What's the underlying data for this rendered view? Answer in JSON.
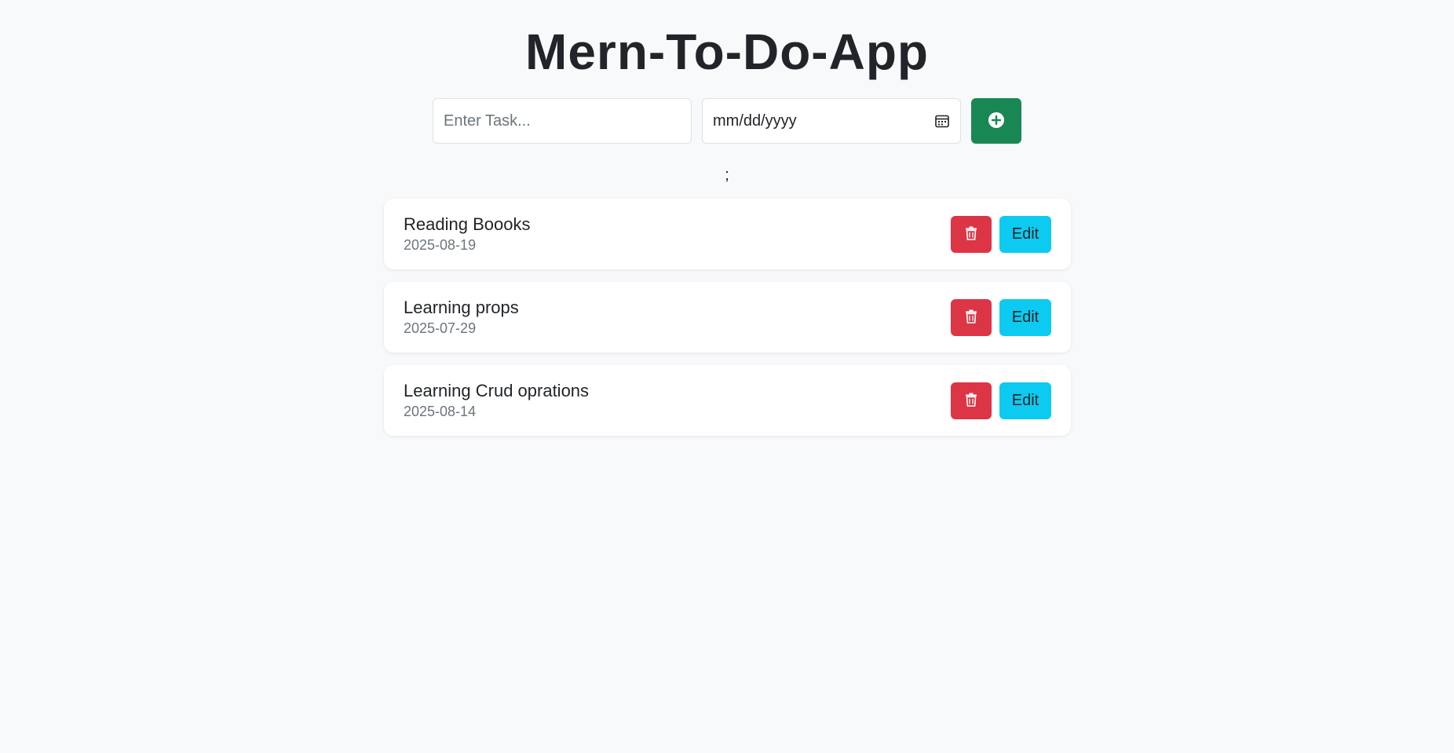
{
  "app": {
    "title": "Mern-To-Do-App"
  },
  "form": {
    "task_placeholder": "Enter Task...",
    "task_value": "",
    "date_placeholder": "mm/dd/yyyy",
    "calendar_icon": "calendar-icon",
    "add_icon": "plus-circle-icon"
  },
  "stray_text": ";",
  "tasks": [
    {
      "title": "Reading Boooks",
      "date": "2025-08-19",
      "edit_label": "Edit"
    },
    {
      "title": "Learning props",
      "date": "2025-07-29",
      "edit_label": "Edit"
    },
    {
      "title": "Learning Crud oprations",
      "date": "2025-08-14",
      "edit_label": "Edit"
    }
  ],
  "colors": {
    "background": "#f8f9fa",
    "add_button": "#198754",
    "delete_button": "#dc3545",
    "edit_button": "#0dcaf0"
  }
}
